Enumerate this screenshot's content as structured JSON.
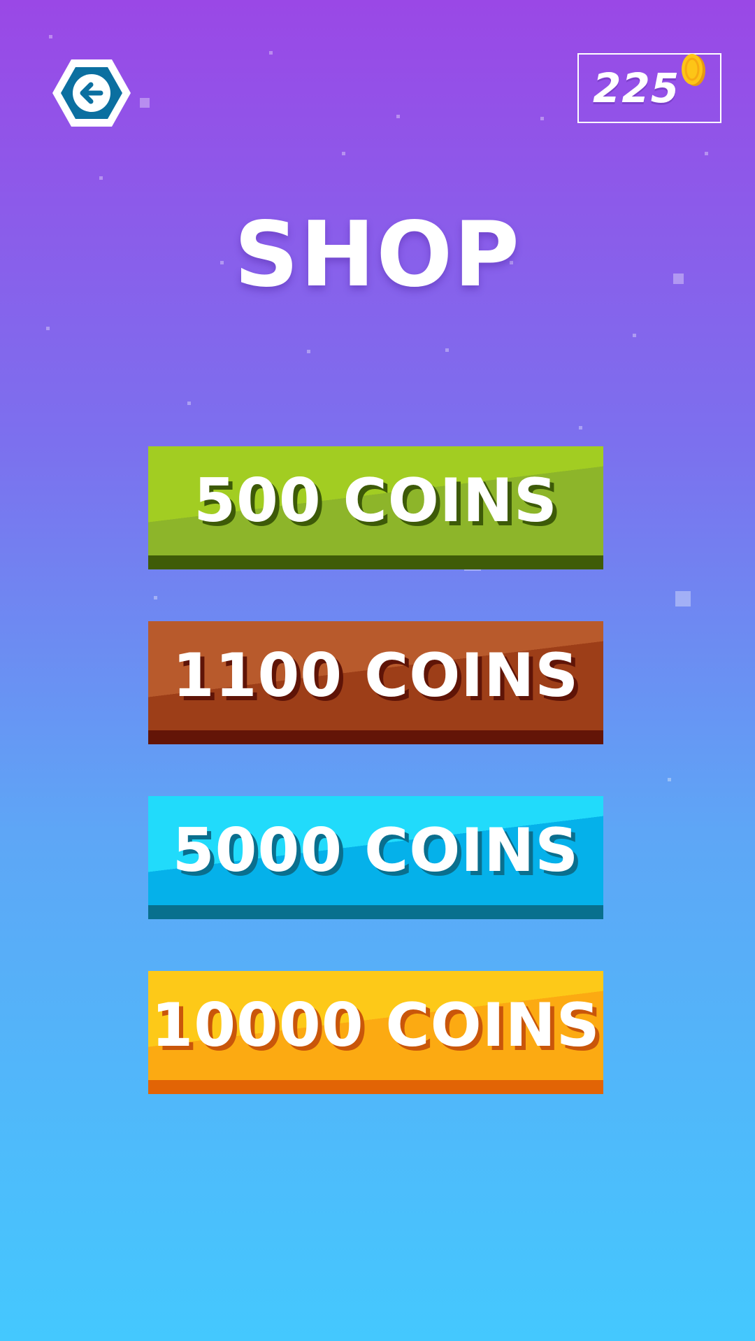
{
  "header": {
    "back_icon": "back-arrow-icon",
    "coin_count": "225",
    "coin_icon": "gold-coin-icon"
  },
  "title": "SHOP",
  "shop_items": [
    {
      "label": "500 COINS",
      "color": "#a2cd22",
      "shadow": "#3f5c08"
    },
    {
      "label": "1100 COINS",
      "color": "#b85a2c",
      "shadow": "#631507"
    },
    {
      "label": "5000 COINS",
      "color": "#21dbfb",
      "shadow": "#08708e"
    },
    {
      "label": "10000 COINS",
      "color": "#fdc918",
      "shadow": "#e26405"
    }
  ],
  "colors": {
    "background_top": "#9a48e6",
    "background_bottom": "#44c8fe",
    "back_button": "#0b6fa0"
  }
}
